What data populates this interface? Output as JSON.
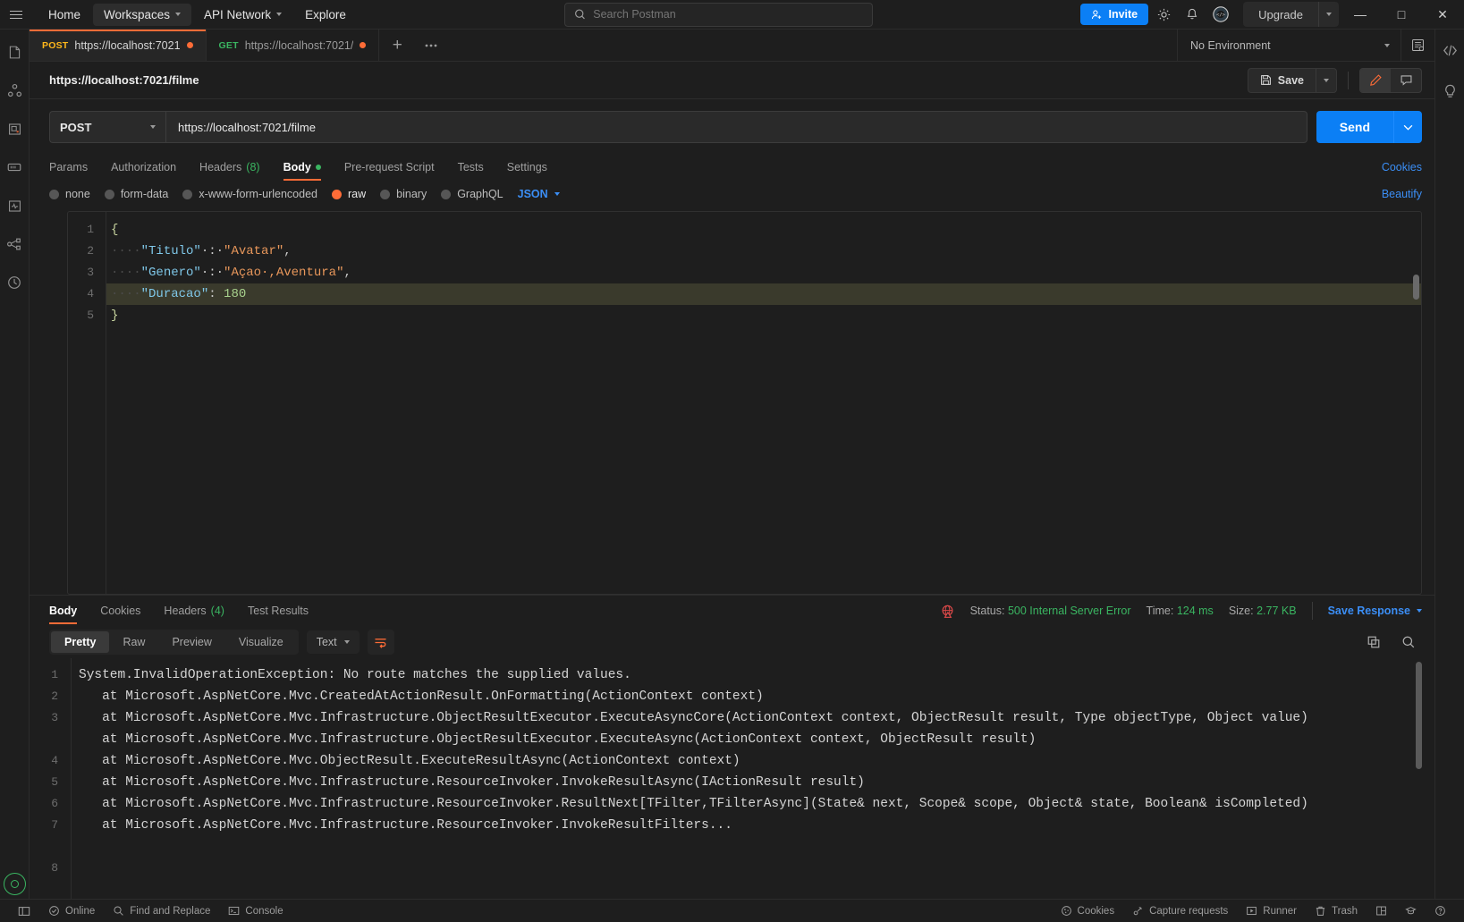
{
  "titlebar": {
    "nav": [
      {
        "label": "Home",
        "caret": false,
        "active": false
      },
      {
        "label": "Workspaces",
        "caret": true,
        "active": true
      },
      {
        "label": "API Network",
        "caret": true,
        "active": false
      },
      {
        "label": "Explore",
        "caret": false,
        "active": false
      }
    ],
    "search_placeholder": "Search Postman",
    "invite_label": "Invite",
    "upgrade_label": "Upgrade",
    "icons": [
      "search-icon",
      "settings-gear-icon",
      "notification-bell-icon",
      "user-avatar-icon"
    ],
    "window": {
      "minimize": "—",
      "maximize": "□",
      "close": "✕"
    }
  },
  "sidebar": {
    "items": [
      {
        "name": "collections-icon"
      },
      {
        "name": "apis-icon"
      },
      {
        "name": "environments-icon"
      },
      {
        "name": "mock-servers-icon"
      },
      {
        "name": "monitors-icon"
      },
      {
        "name": "flows-icon"
      },
      {
        "name": "history-icon"
      }
    ]
  },
  "tabs": [
    {
      "method": "POST",
      "title": "https://localhost:7021",
      "unsaved": true,
      "active": true
    },
    {
      "method": "GET",
      "title": "https://localhost:7021/",
      "unsaved": true,
      "active": false
    }
  ],
  "tabbar": {
    "add_label": "+",
    "more_label": "●●●"
  },
  "environment": {
    "selected": "No Environment"
  },
  "request": {
    "title": "https://localhost:7021/filme",
    "save_label": "Save",
    "method": "POST",
    "url": "https://localhost:7021/filme",
    "send_label": "Send",
    "tabs": [
      {
        "label": "Params",
        "active": false
      },
      {
        "label": "Authorization",
        "active": false
      },
      {
        "label": "Headers",
        "count": "(8)",
        "active": false
      },
      {
        "label": "Body",
        "dot": true,
        "active": true
      },
      {
        "label": "Pre-request Script",
        "active": false
      },
      {
        "label": "Tests",
        "active": false
      },
      {
        "label": "Settings",
        "active": false
      }
    ],
    "cookies_label": "Cookies",
    "beautify_label": "Beautify",
    "body_types": [
      {
        "label": "none",
        "selected": false
      },
      {
        "label": "form-data",
        "selected": false
      },
      {
        "label": "x-www-form-urlencoded",
        "selected": false
      },
      {
        "label": "raw",
        "selected": true
      },
      {
        "label": "binary",
        "selected": false
      },
      {
        "label": "GraphQL",
        "selected": false
      }
    ],
    "raw_format": "JSON"
  },
  "editor": {
    "line_numbers": [
      "1",
      "2",
      "3",
      "4",
      "5"
    ],
    "lines": [
      {
        "tokens": [
          {
            "t": "{",
            "c": "k-brace"
          }
        ],
        "highlight": false
      },
      {
        "tokens": [
          {
            "t": "····",
            "c": "k-dot"
          },
          {
            "t": "\"Titulo\"",
            "c": "k-key"
          },
          {
            "t": "·:·",
            "c": "k-punc"
          },
          {
            "t": "\"Avatar\"",
            "c": "k-str"
          },
          {
            "t": ",",
            "c": "k-punc"
          }
        ],
        "highlight": false
      },
      {
        "tokens": [
          {
            "t": "····",
            "c": "k-dot"
          },
          {
            "t": "\"Genero\"",
            "c": "k-key"
          },
          {
            "t": "·:·",
            "c": "k-punc"
          },
          {
            "t": "\"Açao·,Aventura\"",
            "c": "k-str"
          },
          {
            "t": ",",
            "c": "k-punc"
          }
        ],
        "highlight": false
      },
      {
        "tokens": [
          {
            "t": "····",
            "c": "k-dot"
          },
          {
            "t": "\"Duracao\"",
            "c": "k-key"
          },
          {
            "t": ": ",
            "c": "k-punc"
          },
          {
            "t": "180",
            "c": "k-num"
          }
        ],
        "highlight": true
      },
      {
        "tokens": [
          {
            "t": "}",
            "c": "k-brace"
          }
        ],
        "highlight": false
      }
    ],
    "raw_text": "{\n    \"Titulo\" : \"Avatar\",\n    \"Genero\" : \"Açao ,Aventura\",\n    \"Duracao\": 180\n}"
  },
  "response": {
    "tabs": [
      {
        "label": "Body",
        "active": true
      },
      {
        "label": "Cookies",
        "active": false
      },
      {
        "label": "Headers",
        "count": "(4)",
        "active": false
      },
      {
        "label": "Test Results",
        "active": false
      }
    ],
    "status_label": "Status:",
    "status_value": "500 Internal Server Error",
    "time_label": "Time:",
    "time_value": "124 ms",
    "size_label": "Size:",
    "size_value": "2.77 KB",
    "save_response_label": "Save Response",
    "view_modes": [
      {
        "label": "Pretty",
        "active": true
      },
      {
        "label": "Raw",
        "active": false
      },
      {
        "label": "Preview",
        "active": false
      },
      {
        "label": "Visualize",
        "active": false
      }
    ],
    "format": "Text",
    "line_numbers": [
      "1",
      "2",
      "3",
      "4",
      "5",
      "6",
      "7",
      "8"
    ],
    "lines": [
      "System.InvalidOperationException: No route matches the supplied values.",
      "   at Microsoft.AspNetCore.Mvc.CreatedAtActionResult.OnFormatting(ActionContext context)",
      "   at Microsoft.AspNetCore.Mvc.Infrastructure.ObjectResultExecutor.ExecuteAsyncCore(ActionContext context, ObjectResult result, Type objectType, Object value)",
      "   at Microsoft.AspNetCore.Mvc.Infrastructure.ObjectResultExecutor.ExecuteAsync(ActionContext context, ObjectResult result)",
      "   at Microsoft.AspNetCore.Mvc.ObjectResult.ExecuteResultAsync(ActionContext context)",
      "   at Microsoft.AspNetCore.Mvc.Infrastructure.ResourceInvoker.InvokeResultAsync(IActionResult result)",
      "   at Microsoft.AspNetCore.Mvc.Infrastructure.ResourceInvoker.ResultNext[TFilter,TFilterAsync](State& next, Scope& scope, Object& state, Boolean& isCompleted)",
      "   at Microsoft.AspNetCore.Mvc.Infrastructure.ResourceInvoker.InvokeResultFilters..."
    ]
  },
  "statusbar": {
    "left": [
      {
        "label": "Online",
        "icon": "check-circle-icon"
      },
      {
        "label": "Find and Replace",
        "icon": "search-icon"
      },
      {
        "label": "Console",
        "icon": "terminal-icon"
      }
    ],
    "right": [
      {
        "label": "Cookies",
        "icon": "cookie-icon"
      },
      {
        "label": "Capture requests",
        "icon": "satellite-icon"
      },
      {
        "label": "Runner",
        "icon": "play-icon"
      },
      {
        "label": "Trash",
        "icon": "trash-icon"
      }
    ]
  },
  "colors": {
    "accent": "#ff6c37",
    "blue": "#0b7ff5",
    "green": "#3ab561",
    "bg": "#1e1e1e"
  }
}
